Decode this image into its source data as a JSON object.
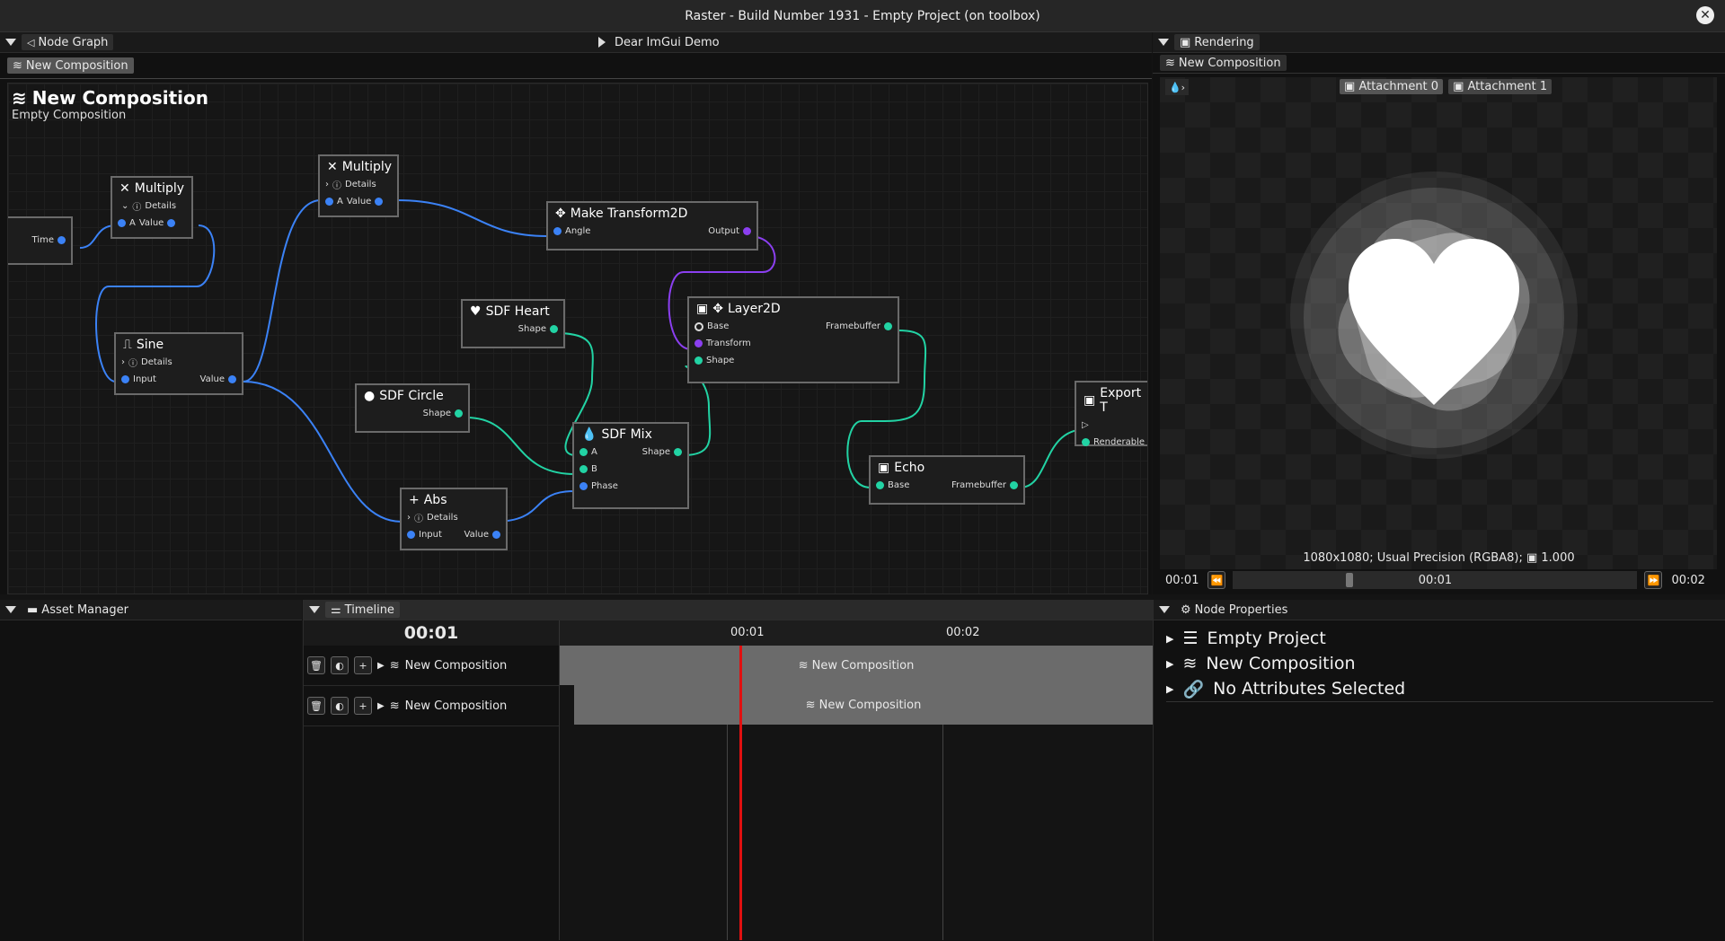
{
  "window": {
    "title": "Raster - Build Number 1931 - Empty Project (on toolbox)"
  },
  "node_graph": {
    "tab_label": "Node Graph",
    "demo_label": "Dear ImGui Demo",
    "composition_tab": "New Composition",
    "heading": "New Composition",
    "subheading": "Empty Composition",
    "nodes": {
      "time": {
        "pin": "Time"
      },
      "multiply1": {
        "title": "Multiply",
        "details": "Details",
        "pin_a": "A",
        "pin_value": "Value"
      },
      "multiply2": {
        "title": "Multiply",
        "details": "Details",
        "pin_a": "A",
        "pin_value": "Value"
      },
      "make_transform": {
        "title": "Make Transform2D",
        "pin_angle": "Angle",
        "pin_output": "Output"
      },
      "sine": {
        "title": "Sine",
        "details": "Details",
        "pin_input": "Input",
        "pin_value": "Value"
      },
      "sdf_heart": {
        "title": "SDF Heart",
        "pin_shape": "Shape"
      },
      "sdf_circle": {
        "title": "SDF Circle",
        "pin_shape": "Shape"
      },
      "layer2d": {
        "title": "Layer2D",
        "pin_base": "Base",
        "pin_framebuffer": "Framebuffer",
        "pin_transform": "Transform",
        "pin_shape": "Shape"
      },
      "sdf_mix": {
        "title": "SDF Mix",
        "pin_a": "A",
        "pin_b": "B",
        "pin_phase": "Phase",
        "pin_shape": "Shape"
      },
      "abs": {
        "title": "Abs",
        "details": "Details",
        "pin_input": "Input",
        "pin_value": "Value"
      },
      "echo": {
        "title": "Echo",
        "pin_base": "Base",
        "pin_framebuffer": "Framebuffer"
      },
      "export": {
        "title": "Export T",
        "pin_renderable": "Renderable"
      }
    }
  },
  "rendering": {
    "tab_label": "Rendering",
    "composition_tab": "New Composition",
    "attachment0": "Attachment 0",
    "attachment1": "Attachment 1",
    "info": "1080x1080; Usual Precision (RGBA8);",
    "zoom": "1.000",
    "time_start": "00:01",
    "time_current": "00:01",
    "time_end": "00:02",
    "playback_progress": 0.28
  },
  "asset_manager": {
    "tab_label": "Asset Manager"
  },
  "timeline": {
    "tab_label": "Timeline",
    "current_time": "00:01",
    "marker1": "00:01",
    "marker2": "00:02",
    "tracks": [
      {
        "name": "New Composition",
        "clip": "New Composition"
      },
      {
        "name": "New Composition",
        "clip": "New Composition"
      }
    ]
  },
  "node_properties": {
    "tab_label": "Node Properties",
    "items": [
      "Empty Project",
      "New Composition",
      "No Attributes Selected"
    ]
  },
  "colors": {
    "accent_blue": "#3b82f6",
    "accent_teal": "#22d3a4",
    "accent_purple": "#8b3ff0",
    "playhead": "#e01010"
  }
}
